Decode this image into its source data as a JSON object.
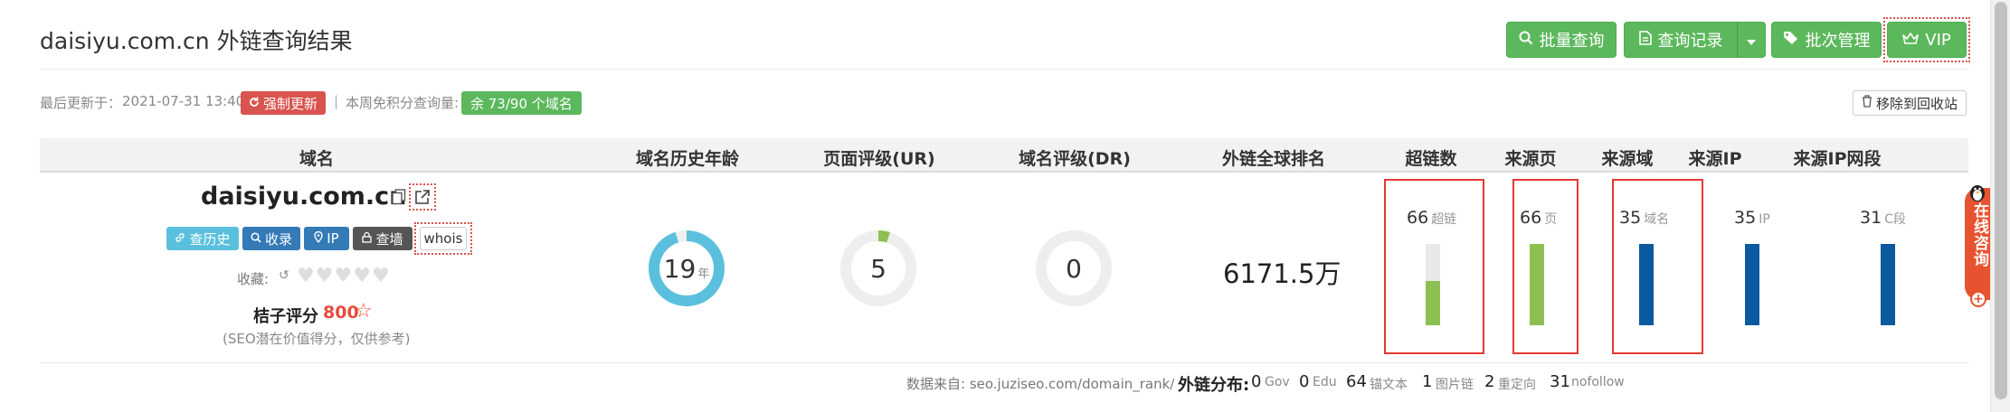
{
  "header": {
    "title": "daisiyu.com.cn 外链查询结果",
    "buttons": {
      "batch_query": "批量查询",
      "query_history": "查询记录",
      "batch_manage": "批次管理",
      "vip": "VIP"
    }
  },
  "meta": {
    "last_update_label": "最后更新于：",
    "last_update_value": "2021-07-31 13:40",
    "force_update": "强制更新",
    "separator": "|",
    "weekly_free_label": "本周免积分查询量:",
    "weekly_free_badge": "余 73/90 个域名",
    "move_to_recycle": "移除到回收站"
  },
  "table": {
    "headers": [
      "域名",
      "域名历史年龄",
      "页面评级(UR)",
      "域名评级(DR)",
      "外链全球排名",
      "超链数",
      "来源页",
      "来源域",
      "来源IP",
      "来源IP网段"
    ],
    "domain": "daisiyu.com.cn",
    "tags": {
      "history": "查历史",
      "index": "收录",
      "ip": "IP",
      "lookup": "查墙",
      "whois": "whois"
    },
    "favorites_label": "收藏:",
    "score_label": "桔子评分",
    "score_value": "800",
    "score_note": "(SEO潜在价值得分，仅供参考)",
    "history_age": {
      "value": "19",
      "unit": "年",
      "fraction": 0.95
    },
    "ur": {
      "value": "5",
      "fraction": 0.05
    },
    "dr": {
      "value": "0",
      "fraction": 0.0
    },
    "global_rank": "6171.5万",
    "metrics": [
      {
        "value": "66",
        "unit": "超链",
        "fill": 0.55,
        "color": "#8cc152"
      },
      {
        "value": "66",
        "unit": "页",
        "fill": 1.0,
        "color": "#8cc152"
      },
      {
        "value": "35",
        "unit": "域名",
        "fill": 1.0,
        "color": "#0b5aa0"
      },
      {
        "value": "35",
        "unit": "IP",
        "fill": 1.0,
        "color": "#0b5aa0"
      },
      {
        "value": "31",
        "unit": "C段",
        "fill": 1.0,
        "color": "#0b5aa0"
      }
    ]
  },
  "footer": {
    "source": "数据来自: seo.juziseo.com/domain_rank/",
    "distribution_label": "外链分布:",
    "distribution": [
      {
        "value": "0",
        "unit": "Gov"
      },
      {
        "value": "0",
        "unit": "Edu"
      },
      {
        "value": "64",
        "unit": "锚文本"
      },
      {
        "value": "1",
        "unit": "图片链"
      },
      {
        "value": "2",
        "unit": "重定向"
      },
      {
        "value": "31",
        "unit": "nofollow"
      }
    ]
  },
  "chat_widget": {
    "label": "在线咨询"
  },
  "colors": {
    "green": "#5cb85c",
    "red": "#d9534f",
    "donut_blue": "#5bc0de",
    "donut_green": "#8cc152",
    "bar_green": "#8cc152",
    "bar_blue": "#0b5aa0",
    "tag_cyan": "#5bc0de",
    "tag_blue": "#337ab7",
    "tag_gray": "#555555"
  }
}
